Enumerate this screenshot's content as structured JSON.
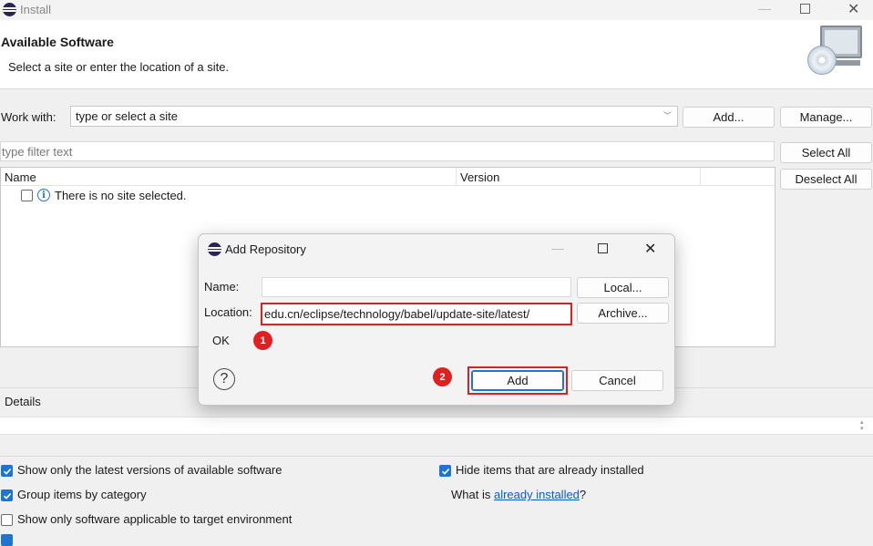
{
  "window": {
    "title": "Install"
  },
  "header": {
    "title": "Available Software",
    "subtitle": "Select a site or enter the location of a site."
  },
  "work_with": {
    "label": "Work with:",
    "placeholder": "type or select a site",
    "add_label": "Add...",
    "manage_label": "Manage..."
  },
  "filter": {
    "placeholder": "type filter text",
    "select_all_label": "Select All",
    "deselect_all_label": "Deselect All"
  },
  "table": {
    "columns": [
      "Name",
      "Version"
    ],
    "rows": [
      {
        "name": "There is no site selected."
      }
    ]
  },
  "details": {
    "label": "Details"
  },
  "options": {
    "latest_versions": "Show only the latest versions of available software",
    "group_by_category": "Group items by category",
    "target_env": "Show only software applicable to target environment",
    "hide_installed": "Hide items that are already installed",
    "what_is_prefix": "What is ",
    "already_installed_link": "already installed",
    "what_is_suffix": "?"
  },
  "dialog": {
    "title": "Add Repository",
    "name_label": "Name:",
    "name_value": "",
    "location_label": "Location:",
    "location_value": "edu.cn/eclipse/technology/babel/update-site/latest/",
    "local_label": "Local...",
    "archive_label": "Archive...",
    "status": "OK",
    "add_label": "Add",
    "cancel_label": "Cancel",
    "help_glyph": "?"
  },
  "annotations": {
    "marker1": "1",
    "marker2": "2"
  },
  "colors": {
    "accent": "#1f74d0",
    "highlight": "#e02020",
    "link": "#0a5bd3"
  }
}
